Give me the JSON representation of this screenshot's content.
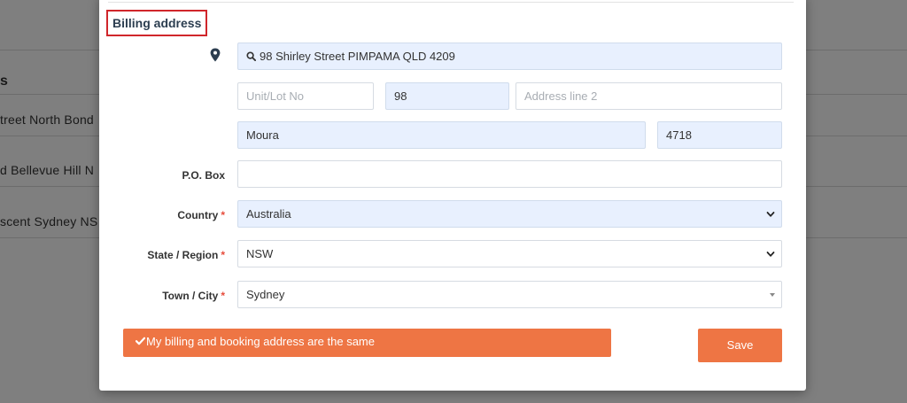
{
  "background": {
    "heading_fragment": "s",
    "rows": [
      {
        "text": "treet North Bond"
      },
      {
        "text": "d Bellevue Hill N"
      },
      {
        "text": "scent Sydney NS"
      }
    ]
  },
  "billing": {
    "title": "Billing address",
    "address_search": {
      "icon": "search-icon",
      "value": "98 Shirley Street  PIMPAMA QLD 4209"
    },
    "unit": {
      "placeholder": "Unit/Lot No",
      "value": ""
    },
    "street_number": {
      "value": "98"
    },
    "address_line2": {
      "placeholder": "Address line 2",
      "value": ""
    },
    "suburb": {
      "value": "Moura"
    },
    "postcode": {
      "value": "4718"
    },
    "po_box": {
      "label": "P.O. Box",
      "value": ""
    },
    "country": {
      "label": "Country",
      "required_mark": "*",
      "value": "Australia"
    },
    "state": {
      "label": "State / Region",
      "required_mark": "*",
      "value": "NSW"
    },
    "town": {
      "label": "Town / City",
      "required_mark": "*",
      "value": "Sydney"
    }
  },
  "actions": {
    "same_address_label": "My billing and booking address are the same",
    "save_label": "Save"
  },
  "colors": {
    "accent": "#ee7544",
    "field_filled_bg": "#e8f0fe",
    "title_outline": "#d0262b",
    "required": "#e74c3c"
  }
}
